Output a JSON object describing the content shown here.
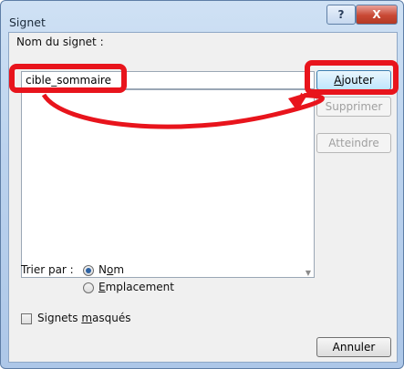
{
  "window": {
    "title": "Signet",
    "help_glyph": "?",
    "close_glyph": "X"
  },
  "form": {
    "name_label": "Nom du signet :",
    "name_value": "cible_sommaire",
    "sort_label": "Trier par :",
    "sort_options": [
      {
        "label_pre": "N",
        "label_access": "o",
        "label_post": "m",
        "checked": true
      },
      {
        "label_pre": "",
        "label_access": "E",
        "label_post": "mplacement",
        "checked": false
      }
    ],
    "hidden_label_pre": "Signets ",
    "hidden_label_access": "m",
    "hidden_label_post": "asqués",
    "hidden_checked": false,
    "list_items": []
  },
  "buttons": {
    "add_access": "A",
    "add_rest": "jouter",
    "delete": "Supprimer",
    "goto": "Atteindre",
    "cancel": "Annuler"
  },
  "annotation": {
    "highlight_color": "#e8141c"
  }
}
